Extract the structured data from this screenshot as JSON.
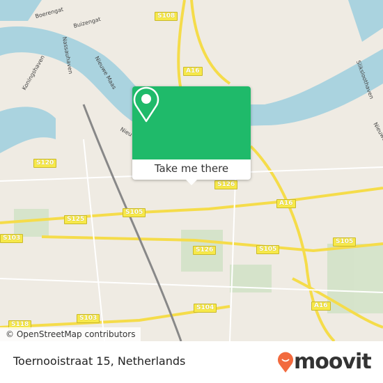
{
  "map": {
    "shields": [
      "S108",
      "A16",
      "A16",
      "A16",
      "S120",
      "S125",
      "S103",
      "S105",
      "S105",
      "S105",
      "S126",
      "S126",
      "S104",
      "S118",
      "S103"
    ],
    "streets": [
      "Boerengat",
      "Buizengat",
      "Nassauhaven",
      "Koningshaven",
      "Nieuwe Maas",
      "Nieu",
      "Sliksloothaven",
      "Nieuwe Maas"
    ],
    "attribution": "© OpenStreetMap contributors",
    "colors": {
      "water": "#aad3df",
      "land": "#efebe3",
      "motorway": "#f7e94a",
      "popup": "#1fba6a"
    }
  },
  "popup": {
    "icon": "map-pin-icon",
    "button_label": "Take me there"
  },
  "footer": {
    "address": "Toernooistraat 15, Netherlands",
    "logo": "moovit",
    "logo_color": "#f26a3e"
  }
}
